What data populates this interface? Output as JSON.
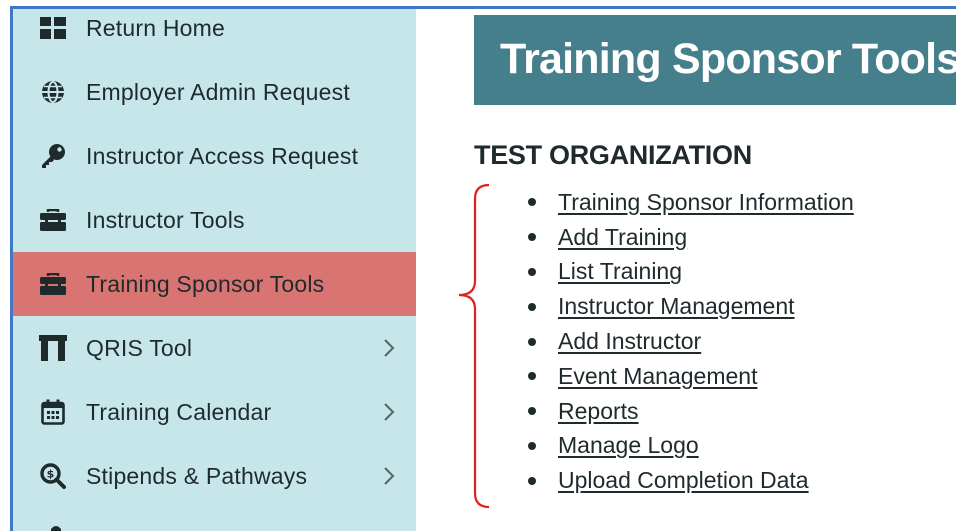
{
  "sidebar": {
    "items": [
      {
        "label": "Return Home",
        "icon": "grid-icon"
      },
      {
        "label": "Employer Admin Request",
        "icon": "globe-icon"
      },
      {
        "label": "Instructor Access Request",
        "icon": "key-icon"
      },
      {
        "label": "Instructor Tools",
        "icon": "toolbox-icon"
      },
      {
        "label": "Training Sponsor Tools",
        "icon": "toolbox-icon",
        "active": true
      },
      {
        "label": "QRIS Tool",
        "icon": "arch-icon",
        "chevron": true
      },
      {
        "label": "Training Calendar",
        "icon": "calendar-icon",
        "chevron": true
      },
      {
        "label": "Stipends & Pathways",
        "icon": "search-dollar-icon",
        "chevron": true
      }
    ],
    "active_color": "#d87572",
    "background_color": "#c6e6e9"
  },
  "main": {
    "banner_title": "Training Sponsor Tools",
    "banner_color": "#457f8c",
    "org_name": "TEST ORGANIZATION",
    "links": [
      "Training Sponsor Information",
      "Add Training",
      "List Training",
      "Instructor Management",
      "Add Instructor",
      "Event Management",
      "Reports",
      "Manage Logo",
      "Upload Completion Data"
    ],
    "annotation_color": "#e0201f"
  }
}
